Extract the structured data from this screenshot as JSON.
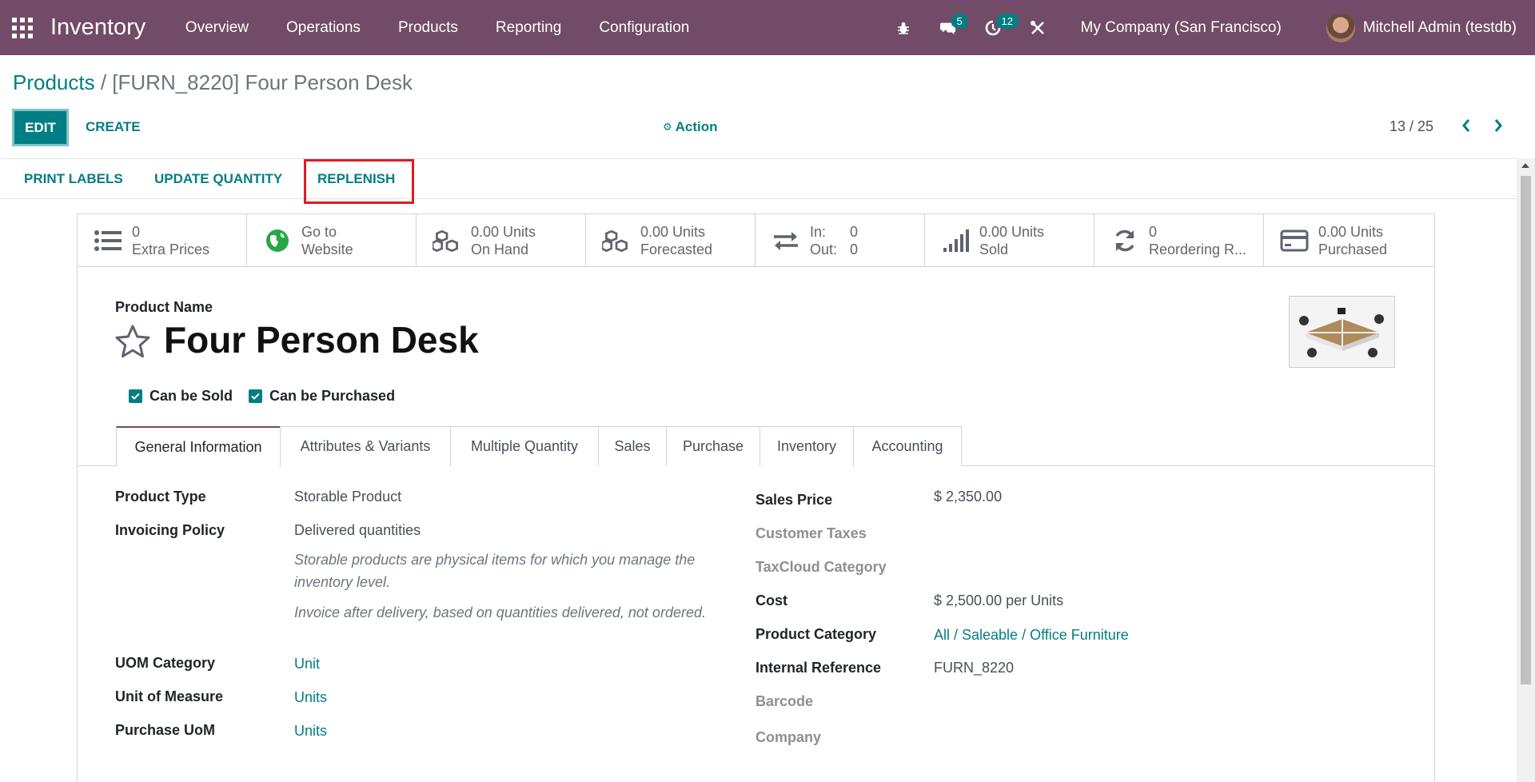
{
  "navbar": {
    "app_name": "Inventory",
    "menu": [
      "Overview",
      "Operations",
      "Products",
      "Reporting",
      "Configuration"
    ],
    "messages_count": "5",
    "activities_count": "12",
    "company": "My Company (San Francisco)",
    "user": "Mitchell Admin (testdb)"
  },
  "breadcrumb": {
    "root": "Products",
    "separator": " / ",
    "current": "[FURN_8220] Four Person Desk"
  },
  "control": {
    "edit_label": "EDIT",
    "create_label": "CREATE",
    "action_label": "Action",
    "pager": "13 / 25"
  },
  "statusbar": {
    "print_labels": "PRINT LABELS",
    "update_quantity": "UPDATE QUANTITY",
    "replenish": "REPLENISH"
  },
  "smart_buttons": {
    "extra_prices": {
      "value": "0",
      "label": "Extra Prices"
    },
    "website": {
      "line1": "Go to",
      "line2": "Website"
    },
    "on_hand": {
      "value": "0.00 Units",
      "label": "On Hand"
    },
    "forecasted": {
      "value": "0.00 Units",
      "label": "Forecasted"
    },
    "in_out": {
      "in_label": "In:",
      "in_value": "0",
      "out_label": "Out:",
      "out_value": "0"
    },
    "sold": {
      "value": "0.00 Units",
      "label": "Sold"
    },
    "reordering": {
      "value": "0",
      "label": "Reordering R..."
    },
    "purchased": {
      "value": "0.00 Units",
      "label": "Purchased"
    }
  },
  "product": {
    "name_label": "Product Name",
    "name": "Four Person Desk",
    "can_be_sold": "Can be Sold",
    "can_be_purchased": "Can be Purchased"
  },
  "tabs": [
    "General Information",
    "Attributes & Variants",
    "Multiple Quantity",
    "Sales",
    "Purchase",
    "Inventory",
    "Accounting"
  ],
  "general": {
    "product_type_label": "Product Type",
    "product_type": "Storable Product",
    "invoicing_policy_label": "Invoicing Policy",
    "invoicing_policy": "Delivered quantities",
    "help_type": "Storable products are physical items for which you manage the inventory level.",
    "help_invoice": "Invoice after delivery, based on quantities delivered, not ordered.",
    "uom_category_label": "UOM Category",
    "uom_category": "Unit",
    "uom_label": "Unit of Measure",
    "uom": "Units",
    "purchase_uom_label": "Purchase UoM",
    "purchase_uom": "Units",
    "sales_price_label": "Sales Price",
    "sales_price": "$ 2,350.00",
    "customer_taxes_label": "Customer Taxes",
    "taxcloud_label": "TaxCloud Category",
    "cost_label": "Cost",
    "cost": "$ 2,500.00",
    "cost_unit": "per Units",
    "category_label": "Product Category",
    "category": "All / Saleable / Office Furniture",
    "internal_ref_label": "Internal Reference",
    "internal_ref": "FURN_8220",
    "barcode_label": "Barcode",
    "company_label": "Company"
  },
  "colors": {
    "navbar": "#714B67",
    "primary": "#017e84",
    "highlight": "#e21b23"
  }
}
